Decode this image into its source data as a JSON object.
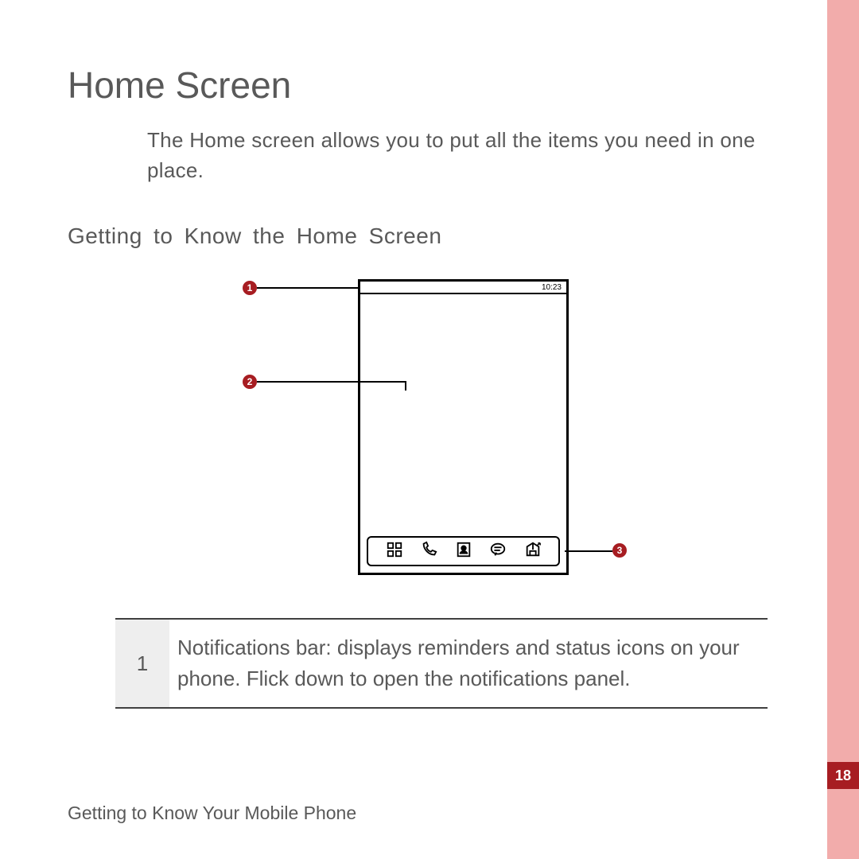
{
  "title": "Home Screen",
  "intro": "The Home screen allows you to put all the items you need in one place.",
  "subheading": "Getting to Know the Home Screen",
  "diagram": {
    "status_time": "10:23",
    "callouts": {
      "c1": "1",
      "c2": "2",
      "c3": "3"
    },
    "dock_icons": [
      "grid-icon",
      "phone-icon",
      "contact-icon",
      "messaging-icon",
      "browser-icon"
    ]
  },
  "table": {
    "rows": [
      {
        "num": "1",
        "desc": "Notifications bar: displays reminders and status icons on your phone. Flick down to open the notifications panel."
      }
    ]
  },
  "footer": "Getting to Know Your Mobile Phone",
  "page_number": "18"
}
